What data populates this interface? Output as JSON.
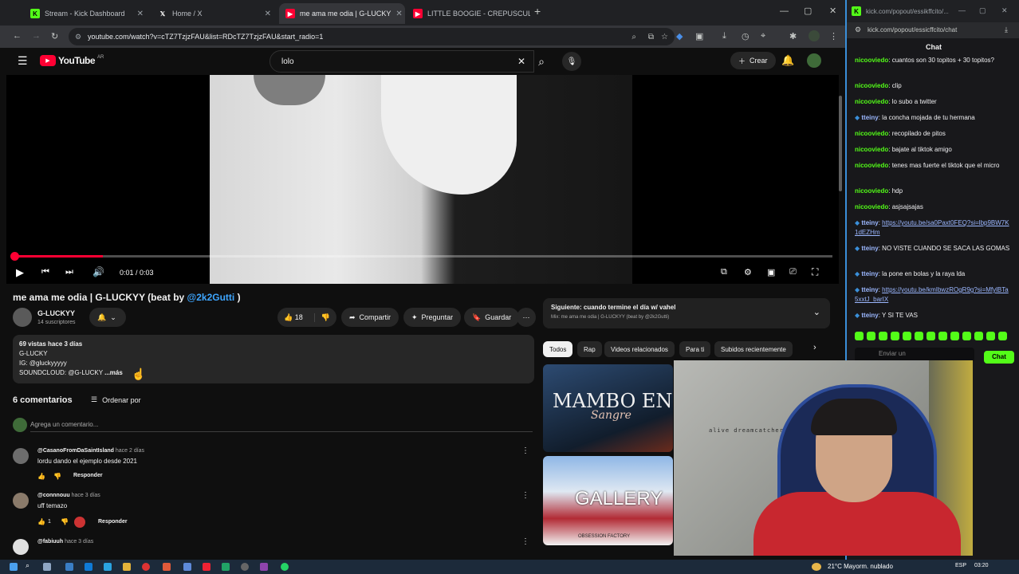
{
  "browser": {
    "tabs": [
      {
        "label": "Stream - Kick Dashboard",
        "favicon": "kick-icon"
      },
      {
        "label": "Home / X",
        "favicon": "x-icon"
      },
      {
        "label": "me ama me odia | G-LUCKY",
        "favicon": "youtube-icon"
      },
      {
        "label": "LITTLE BOOGIE - CREPUSCULO",
        "favicon": "youtube-icon"
      }
    ],
    "url": "youtube.com/watch?v=cTZ7TzjzFAU&list=RDcTZ7TzjzFAU&start_radio=1"
  },
  "youtube": {
    "logo": "YouTube",
    "logo_suffix": "AR",
    "search_value": "lolo",
    "create_label": "Crear",
    "player": {
      "time": "0:01 / 0:03",
      "progress": 0.11
    },
    "video_title_prefix": "me ama me odia | G-LUCKYY (beat by ",
    "video_title_link": "@2k2Gutti",
    "video_title_suffix": " )",
    "channel_name": "G-LUCKYY",
    "subscribers": "14 suscriptores",
    "likes": "18",
    "share_label": "Compartir",
    "ask_label": "Preguntar",
    "save_label": "Guardar",
    "description": {
      "line1": "69 vistas  hace 3 días",
      "line2": "G-LUCKY",
      "line3": "IG: @gluckyyyyy",
      "line4": "SOUNDCLOUD: @G-LUCKY",
      "more": "...más"
    },
    "comments_count": "6 comentarios",
    "sort_label": "Ordenar por",
    "add_comment_placeholder": "Agrega un comentario...",
    "comments": [
      {
        "author": "@CasanoFromDaSaintIsland",
        "time": "hace 2 días",
        "text": "lordu dando el ejemplo desde 2021",
        "likes": "",
        "reply": "Responder",
        "avatar_color": "#6d6d6d"
      },
      {
        "author": "@connnouu",
        "time": "hace 3 días",
        "text": "uff temazo",
        "likes": "1",
        "reply": "Responder",
        "avatar_color": "#8a7a6a"
      },
      {
        "author": "@fabiuuh",
        "time": "hace 3 días",
        "text": "",
        "likes": "",
        "reply": "",
        "avatar_color": "#e0e0e0"
      }
    ],
    "next_up": {
      "label": "Siguiente: cuando termine el día w/ vahel",
      "sub": "Mix: me ama me odia | G-LUCKYY (beat by @2k2Gutti)"
    },
    "chips": [
      "Todos",
      "Rap",
      "Videos relacionados",
      "Para ti",
      "Subidos recientemente"
    ],
    "related": [
      {
        "text": "MAMBO EN LA",
        "subtitle": "Sangre"
      },
      {
        "text": "GALLERY",
        "subtitle": "OBSESSION FACTORY"
      }
    ]
  },
  "kick": {
    "url": "kick.com/popout/essicffcito/chat",
    "window_title": "kick.com/popout/essikffcito/...",
    "header": "Chat",
    "input_placeholder": "Enviar un",
    "send_label": "Chat",
    "messages": [
      {
        "user": "nicooviedo",
        "text": "cuantos son 30 topitos + 30 topitos?",
        "link": false
      },
      {
        "user": "nicooviedo",
        "text": "clip",
        "link": false
      },
      {
        "user": "nicooviedo",
        "text": "lo subo a twitter",
        "link": false
      },
      {
        "user": "tteiny",
        "text": "la concha mojada de tu hermana",
        "link": false
      },
      {
        "user": "nicooviedo",
        "text": "recopilado de pitos",
        "link": false
      },
      {
        "user": "nicooviedo",
        "text": "bajate al tiktok amigo",
        "link": false
      },
      {
        "user": "nicooviedo",
        "text": "tenes mas fuerte el tiktok que el micro",
        "link": false
      },
      {
        "user": "nicooviedo",
        "text": "hdp",
        "link": false
      },
      {
        "user": "nicooviedo",
        "text": "asjsajsajas",
        "link": false
      },
      {
        "user": "tteiny",
        "text": "https://youtu.be/sa0Paxt0FEQ?si=lbp9BW7K1dEZHm",
        "link": true
      },
      {
        "user": "tteiny",
        "text": "NO VISTE CUANDO SE SACA LAS GOMAS",
        "link": false
      },
      {
        "user": "tteiny",
        "text": "la pone en bolas y la raya lda",
        "link": false
      },
      {
        "user": "tteiny",
        "text": "https://youtu.be/kmIbwzROgR9g?si=MfylBTa5xxtJ_barIX",
        "link": true
      },
      {
        "user": "tteiny",
        "text": "Y SI TE VAS",
        "link": false
      }
    ]
  },
  "webcam": {
    "overlay_text": "alive dreamcatcher"
  },
  "taskbar": {
    "weather": "21°C  Mayorm. nublado",
    "lang": "ESP",
    "time": "03:20"
  }
}
